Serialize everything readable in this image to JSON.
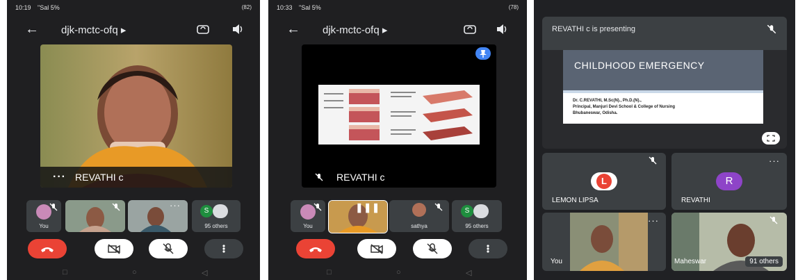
{
  "screens": [
    {
      "status": {
        "time": "10:19",
        "signal": "\"Sal 5%",
        "battery": "(82)"
      },
      "meeting_code": "djk-mctc-ofq",
      "main_tile": {
        "name": "REVATHI c"
      },
      "thumbnails": [
        {
          "label": "You"
        },
        {
          "label": ""
        },
        {
          "label": ""
        },
        {
          "label": "95 others",
          "initial": "S"
        }
      ]
    },
    {
      "status": {
        "time": "10:33",
        "signal": "\"Sal 5%",
        "battery": "(78)"
      },
      "meeting_code": "djk-mctc-ofq",
      "main_tile": {
        "name": "REVATHI c"
      },
      "thumbnails": [
        {
          "label": "You"
        },
        {
          "label": ""
        },
        {
          "label": "sathya"
        },
        {
          "label": "95 others",
          "initial": "S"
        }
      ]
    }
  ],
  "presentation_screen": {
    "banner": "REVATHI c is presenting",
    "slide": {
      "title": "CHILDHOOD EMERGENCY",
      "author_line1": "Dr. C.REVATHI, M.Sc(N)., Ph.D.(N).,",
      "author_line2": "Principal, Manjuri Devi School & College of Nursing",
      "author_line3": "Bhubaneswar, Odisha."
    },
    "tiles": [
      {
        "name": "LEMON LIPSA",
        "initial": "L",
        "color": "#ea4335"
      },
      {
        "name": "REVATHI",
        "initial": "R",
        "color": "#8e44c8"
      },
      {
        "name": "You"
      },
      {
        "name": "Maheswar",
        "others": "91 others"
      }
    ]
  },
  "colors": {
    "end_call": "#ea4335",
    "panel_bg": "#1f1f21",
    "tile_bg": "#3c4043",
    "accent_blue": "#4285f4"
  }
}
